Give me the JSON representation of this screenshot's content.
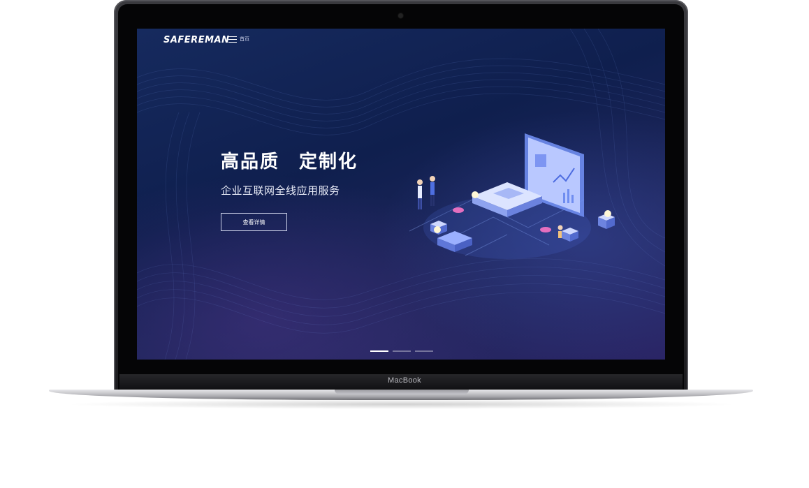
{
  "device": {
    "brand_label": "MacBook"
  },
  "site": {
    "logo_text": "SAFEREMAN",
    "nav": {
      "home_label": "首页"
    }
  },
  "hero": {
    "title": "高品质　定制化",
    "subtitle": "企业互联网全线应用服务",
    "button_label": "查看详情"
  },
  "carousel": {
    "slides": 3,
    "active_index": 0
  },
  "icons": [
    "menu-icon",
    "webcam-icon"
  ],
  "colors": {
    "screen_bg": "#14285a",
    "accent_purple": "#2a2566",
    "text": "#ffffff"
  }
}
